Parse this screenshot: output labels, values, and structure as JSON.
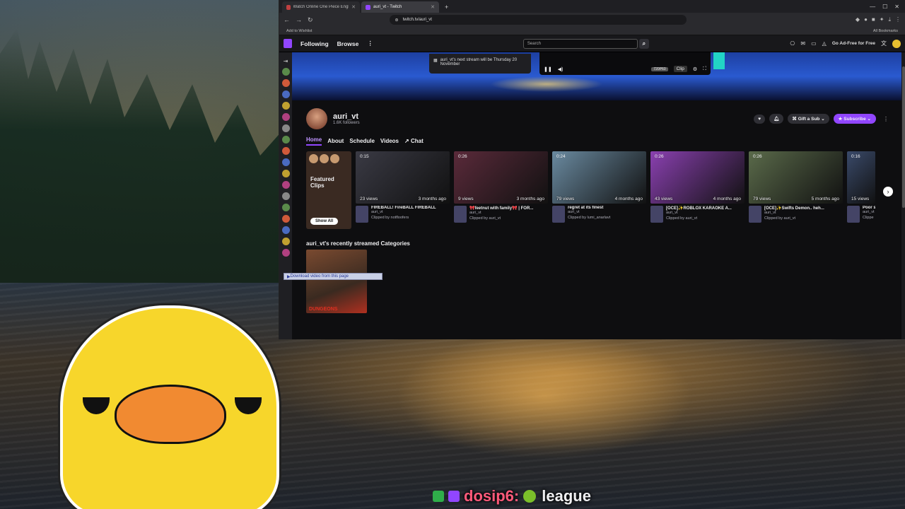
{
  "browser": {
    "tabs": [
      {
        "label": "Watch Online One Piece English Dub",
        "active": false
      },
      {
        "label": "auri_vt - Twitch",
        "active": true
      }
    ],
    "url": "twitch.tv/auri_vt",
    "bookmark_left": "Add to Wishlist",
    "bookmark_right": "All Bookmarks"
  },
  "twitch_nav": {
    "following": "Following",
    "browse": "Browse",
    "search_placeholder": "Search",
    "ad_free": "Go Ad-Free for Free"
  },
  "banner": {
    "next_stream": "auri_vt's next stream will be Thursday 20 November",
    "quality": "720P60",
    "clip_label": "Clip"
  },
  "channel": {
    "name": "auri_vt",
    "followers": "1.6K followers",
    "gift": "Gift a Sub",
    "subscribe": "Subscribe"
  },
  "tabs": [
    "Home",
    "About",
    "Schedule",
    "Videos",
    "Chat"
  ],
  "featured": {
    "label": "Featured Clips",
    "show_all": "Show All"
  },
  "clips": [
    {
      "duration": "0:15",
      "views": "23 views",
      "ago": "3 months ago",
      "title": "FIREBALL! FireBALL FIREBALL",
      "channel": "auri_vt",
      "clipper": "Clipped by notfloofers",
      "color": "#3a3a44"
    },
    {
      "duration": "0:26",
      "views": "9 views",
      "ago": "3 months ago",
      "title": "🎀feetnut with family🎀 | FOR...",
      "channel": "auri_vt",
      "clipper": "Clipped by auri_vt",
      "color": "#5a2a3a"
    },
    {
      "duration": "0:24",
      "views": "79 views",
      "ago": "4 months ago",
      "title": "regret at its finest",
      "channel": "auri_vt",
      "clipper": "Clipped by lumi_anarlavt",
      "color": "#6a8aa0"
    },
    {
      "duration": "0:26",
      "views": "43 views",
      "ago": "4 months ago",
      "title": "[OCE]✨ROBLOX KARAOKE A...",
      "channel": "auri_vt",
      "clipper": "Clipped by auri_vt",
      "color": "#8a40b0"
    },
    {
      "duration": "0:26",
      "views": "79 views",
      "ago": "5 months ago",
      "title": "[OCE]✨Swifts Demon.. heh...",
      "channel": "auri_vt",
      "clipper": "Clipped by auri_vt",
      "color": "#5a6a4a"
    },
    {
      "duration": "0:16",
      "views": "15 views",
      "ago": "",
      "title": "Poor s",
      "channel": "auri_vt",
      "clipper": "Clippe",
      "color": "#3a4a6a"
    }
  ],
  "recent_title": "auri_vt's recently streamed Categories",
  "category": "DUNGEONS",
  "download_bar": "Download video from this page",
  "chat_overlay": {
    "user": "dosip6:",
    "message": "league"
  }
}
